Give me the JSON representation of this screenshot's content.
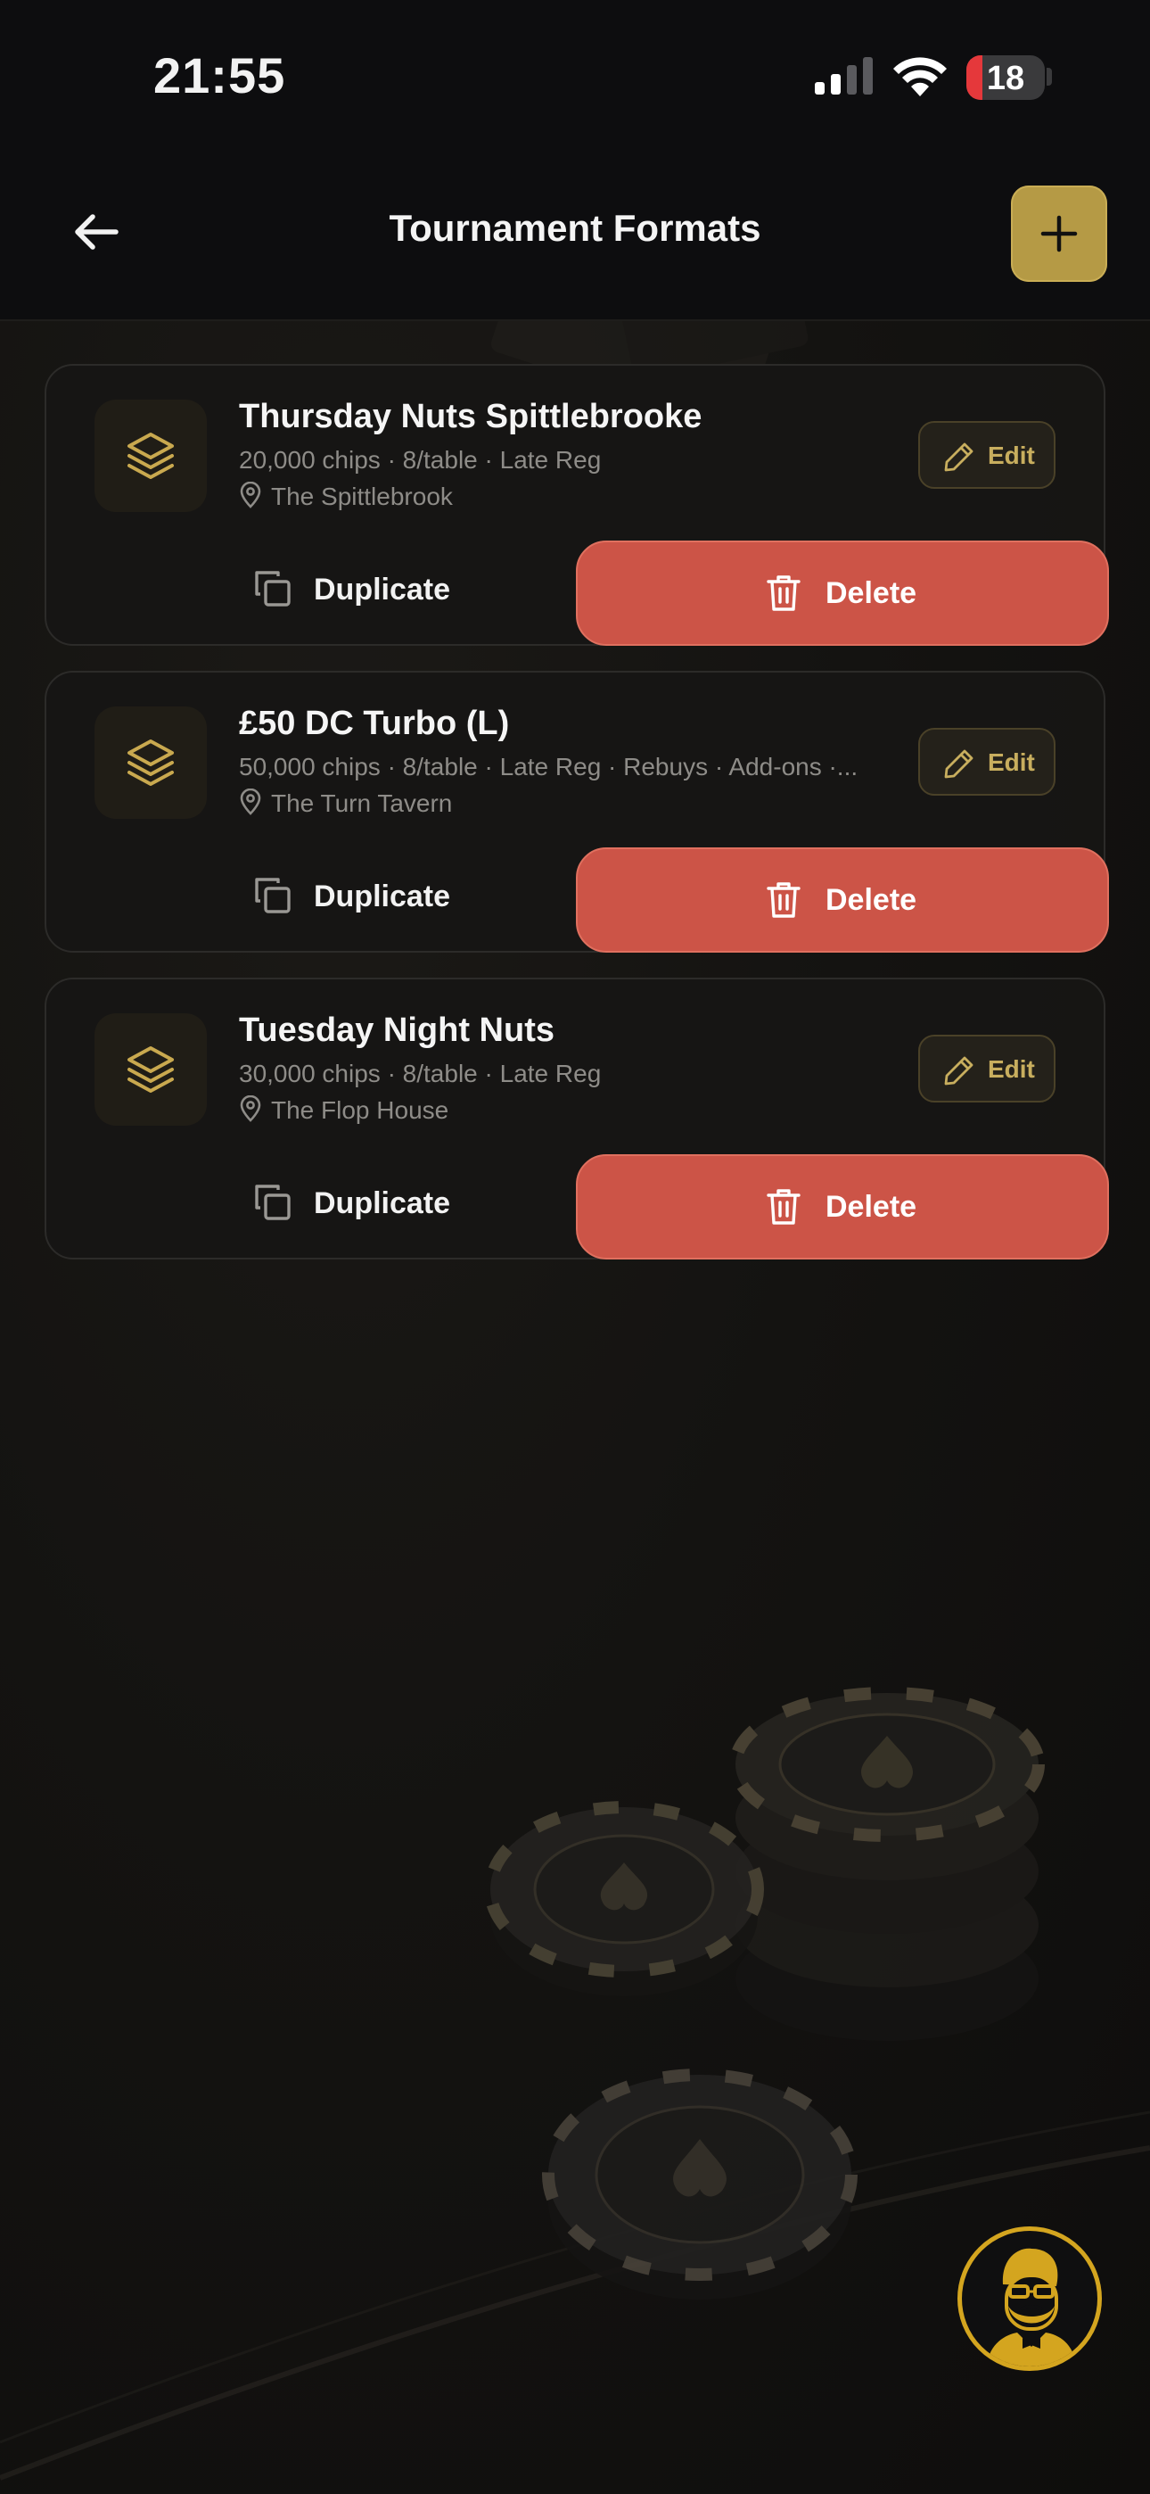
{
  "status_bar": {
    "time": "21:55",
    "battery": "18"
  },
  "header": {
    "title": "Tournament Formats",
    "back_icon": "arrow-left-icon",
    "add_icon": "plus-icon"
  },
  "colors": {
    "accent": "#b59a45",
    "delete": "#cc5447",
    "background": "#12110f"
  },
  "formats": [
    {
      "title": "Thursday Nuts Spittlebrooke",
      "meta": "20,000 chips · 8/table · Late Reg",
      "location": "The Spittlebrook",
      "edit_label": "Edit",
      "duplicate_label": "Duplicate",
      "delete_label": "Delete"
    },
    {
      "title": "£50 DC Turbo (L)",
      "meta": "50,000 chips · 8/table · Late Reg · Rebuys · Add-ons ·...",
      "location": "The Turn Tavern",
      "edit_label": "Edit",
      "duplicate_label": "Duplicate",
      "delete_label": "Delete"
    },
    {
      "title": "Tuesday Night Nuts",
      "meta": "30,000 chips · 8/table · Late Reg",
      "location": "The Flop House",
      "edit_label": "Edit",
      "duplicate_label": "Duplicate",
      "delete_label": "Delete"
    }
  ]
}
